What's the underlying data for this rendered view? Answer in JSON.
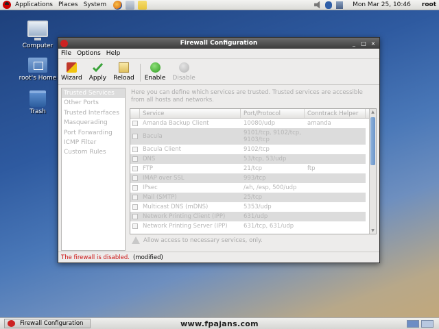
{
  "top_panel": {
    "menus": [
      "Applications",
      "Places",
      "System"
    ],
    "clock": "Mon Mar 25, 10:46",
    "user": "root",
    "colors": {
      "launcher_firefox": "#e07b1d",
      "launcher_mail": "#9aa6b8",
      "launcher_notes": "#e9c53b"
    }
  },
  "desktop": {
    "icons": [
      {
        "label": "Computer",
        "icon": "computer-icon"
      },
      {
        "label": "root's Home",
        "icon": "home-folder-icon"
      },
      {
        "label": "Trash",
        "icon": "trash-icon"
      }
    ]
  },
  "window": {
    "title": "Firewall Configuration",
    "controls": {
      "minimize": "_",
      "maximize": "□",
      "close": "×"
    },
    "menu": [
      "File",
      "Options",
      "Help"
    ],
    "toolbar": {
      "wizard": "Wizard",
      "apply": "Apply",
      "reload": "Reload",
      "enable": "Enable",
      "disable": "Disable"
    },
    "sidebar": [
      "Trusted Services",
      "Other Ports",
      "Trusted Interfaces",
      "Masquerading",
      "Port Forwarding",
      "ICMP Filter",
      "Custom Rules"
    ],
    "description": "Here you can define which services are trusted. Trusted services are accessible from all hosts and networks.",
    "table": {
      "columns": [
        "Service",
        "Port/Protocol",
        "Conntrack Helper"
      ],
      "rows": [
        {
          "service": "Amanda Backup Client",
          "port": "10080/udp",
          "helper": "amanda"
        },
        {
          "service": "Bacula",
          "port": "9101/tcp, 9102/tcp, 9103/tcp",
          "helper": ""
        },
        {
          "service": "Bacula Client",
          "port": "9102/tcp",
          "helper": ""
        },
        {
          "service": "DNS",
          "port": "53/tcp, 53/udp",
          "helper": ""
        },
        {
          "service": "FTP",
          "port": "21/tcp",
          "helper": "ftp"
        },
        {
          "service": "IMAP over SSL",
          "port": "993/tcp",
          "helper": ""
        },
        {
          "service": "IPsec",
          "port": "/ah, /esp, 500/udp",
          "helper": ""
        },
        {
          "service": "Mail (SMTP)",
          "port": "25/tcp",
          "helper": ""
        },
        {
          "service": "Multicast DNS (mDNS)",
          "port": "5353/udp",
          "helper": ""
        },
        {
          "service": "Network Printing Client (IPP)",
          "port": "631/udp",
          "helper": ""
        },
        {
          "service": "Network Printing Server (IPP)",
          "port": "631/tcp, 631/udp",
          "helper": ""
        }
      ]
    },
    "hint": "Allow access to necessary services, only.",
    "status": {
      "message": "The firewall is disabled.",
      "modified": "(modified)",
      "color": "#cc1111"
    }
  },
  "bottom_panel": {
    "task": "Firewall Configuration",
    "watermark": "www.fpajans.com"
  }
}
